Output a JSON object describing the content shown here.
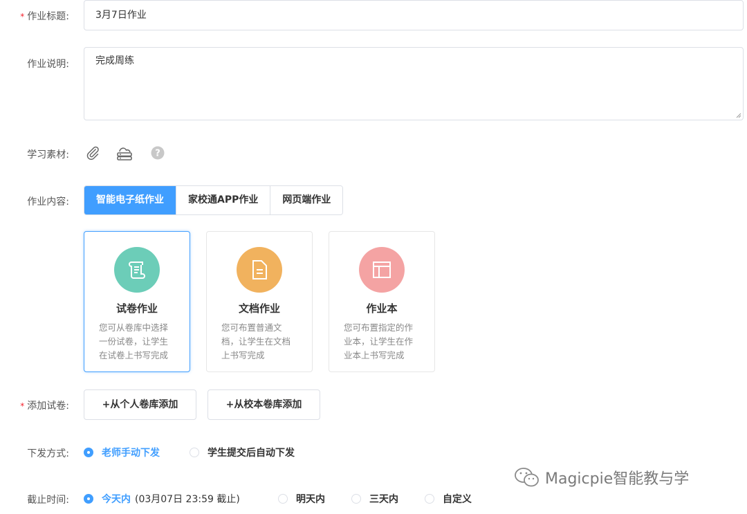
{
  "form": {
    "title_label": "作业标题:",
    "title_value": "3月7日作业",
    "desc_label": "作业说明:",
    "desc_value": "完成周练",
    "material_label": "学习素材:",
    "content_label": "作业内容:",
    "add_label": "添加试卷:",
    "dispatch_label": "下发方式:",
    "deadline_label": "截止时间:",
    "required_mark": "*"
  },
  "tabs": [
    "智能电子纸作业",
    "家校通APP作业",
    "网页端作业"
  ],
  "cards": [
    {
      "title": "试卷作业",
      "desc": "您可从卷库中选择一份试卷，让学生在试卷上书写完成",
      "color": "#6ccdb8"
    },
    {
      "title": "文档作业",
      "desc": "您可布置普通文档，让学生在文档上书写完成",
      "color": "#f1b25e"
    },
    {
      "title": "作业本",
      "desc": "您可布置指定的作业本，让学生在作业本上书写完成",
      "color": "#f4a3a3"
    }
  ],
  "buttons": {
    "personal": "+从个人卷库添加",
    "school": "+从校本卷库添加"
  },
  "dispatch": {
    "manual": "老师手动下发",
    "auto": "学生提交后自动下发"
  },
  "deadline": {
    "today": "今天内",
    "today_note": "(03月07日 23:59 截止)",
    "tomorrow": "明天内",
    "three_days": "三天内",
    "custom": "自定义"
  },
  "watermark": "Magicpie智能教与学",
  "colors": {
    "accent": "#409eff",
    "required": "#f5222d"
  },
  "icons": [
    "paperclip-icon",
    "cloud-drive-icon",
    "help-icon"
  ]
}
